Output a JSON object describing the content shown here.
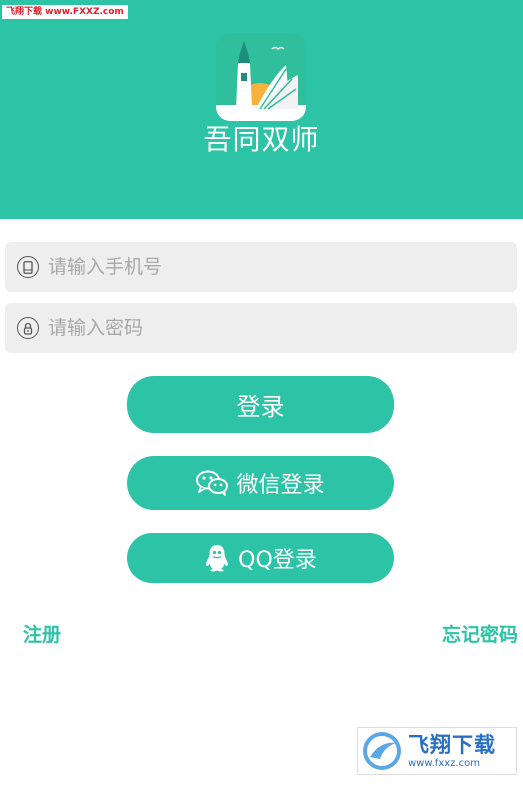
{
  "watermark": {
    "top_text": "飞翔下载 www.FXXZ.com",
    "bottom_title": "飞翔下载",
    "bottom_url": "www.fxxz.com"
  },
  "header": {
    "app_name": "吾同双师",
    "logo_icon": "book-lighthouse-logo",
    "background": "#2dc3a6"
  },
  "form": {
    "phone": {
      "placeholder": "请输入手机号",
      "value": "",
      "icon": "phone-icon"
    },
    "password": {
      "placeholder": "请输入密码",
      "value": "",
      "icon": "lock-icon"
    }
  },
  "buttons": {
    "login_label": "登录",
    "wechat_label": "微信登录",
    "qq_label": "QQ登录"
  },
  "links": {
    "register": "注册",
    "forgot_password": "忘记密码"
  },
  "colors": {
    "accent": "#2dc3a6",
    "input_bg": "#eeeeee",
    "placeholder": "#a8a8a8",
    "watermark_red": "#e0202a",
    "watermark_blue": "#2a6fc4"
  }
}
